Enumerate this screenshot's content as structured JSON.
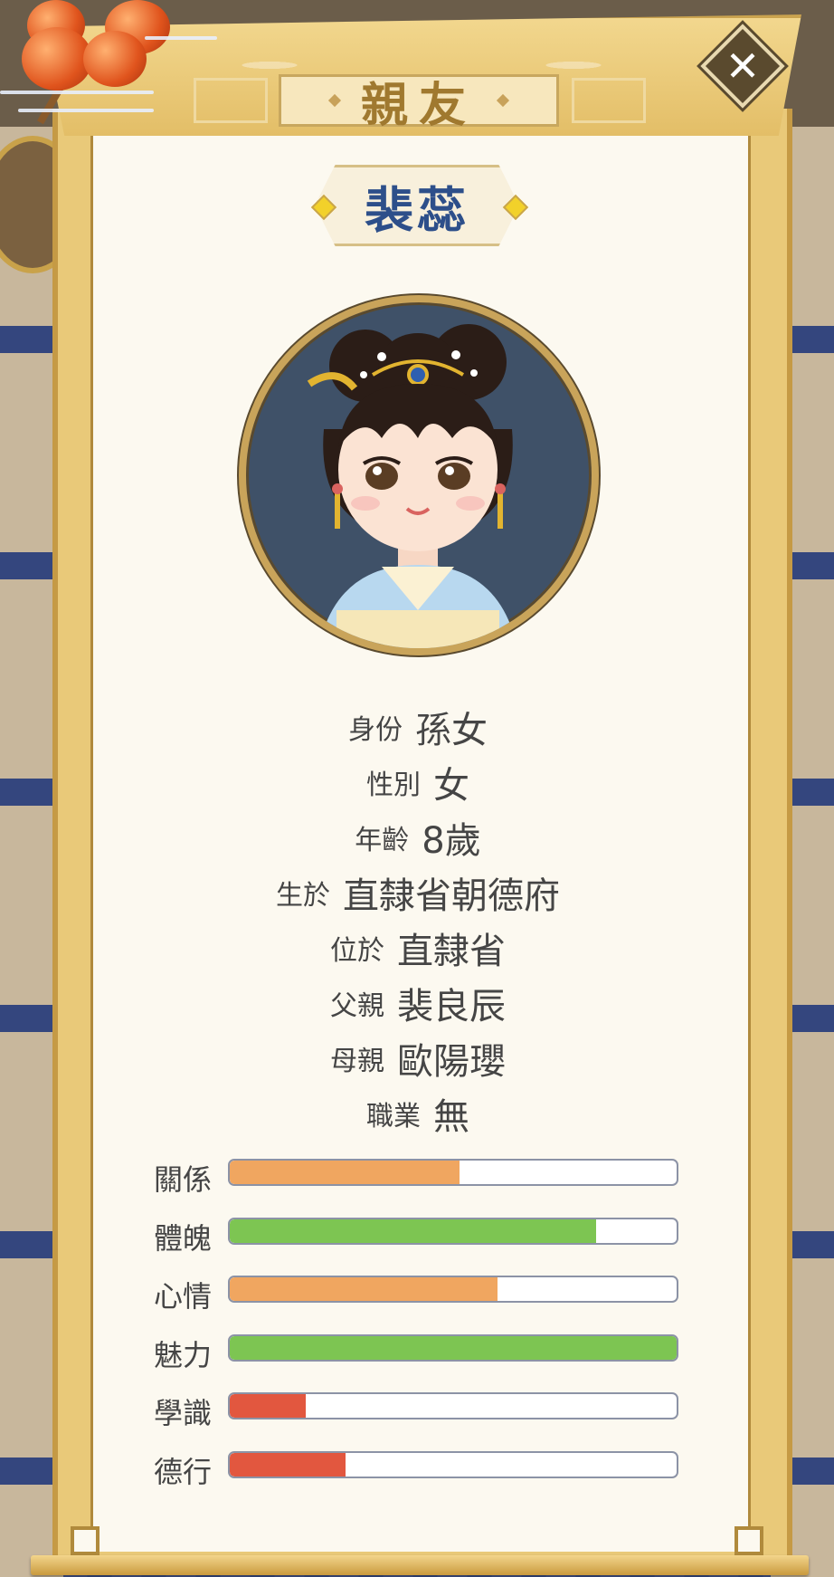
{
  "header": {
    "title": "親友",
    "close_icon": "close-x-icon"
  },
  "profile": {
    "name": "裴蕊",
    "avatar": "girl-portrait-avatar"
  },
  "info": [
    {
      "label": "身份",
      "value": "孫女"
    },
    {
      "label": "性別",
      "value": "女"
    },
    {
      "label": "年齡",
      "value": "8歲"
    },
    {
      "label": "生於",
      "value": "直隸省朝德府"
    },
    {
      "label": "位於",
      "value": "直隸省"
    },
    {
      "label": "父親",
      "value": "裴良辰"
    },
    {
      "label": "母親",
      "value": "歐陽瓔"
    },
    {
      "label": "職業",
      "value": "無"
    }
  ],
  "stats": [
    {
      "label": "關係",
      "fraction": 0.515,
      "color": "#f0a660"
    },
    {
      "label": "體魄",
      "fraction": 0.82,
      "color": "#7dc552"
    },
    {
      "label": "心情",
      "fraction": 0.6,
      "color": "#f0a660"
    },
    {
      "label": "魅力",
      "fraction": 1.0,
      "color": "#7dc552"
    },
    {
      "label": "學識",
      "fraction": 0.17,
      "color": "#e2573f"
    },
    {
      "label": "德行",
      "fraction": 0.26,
      "color": "#e2573f"
    }
  ]
}
